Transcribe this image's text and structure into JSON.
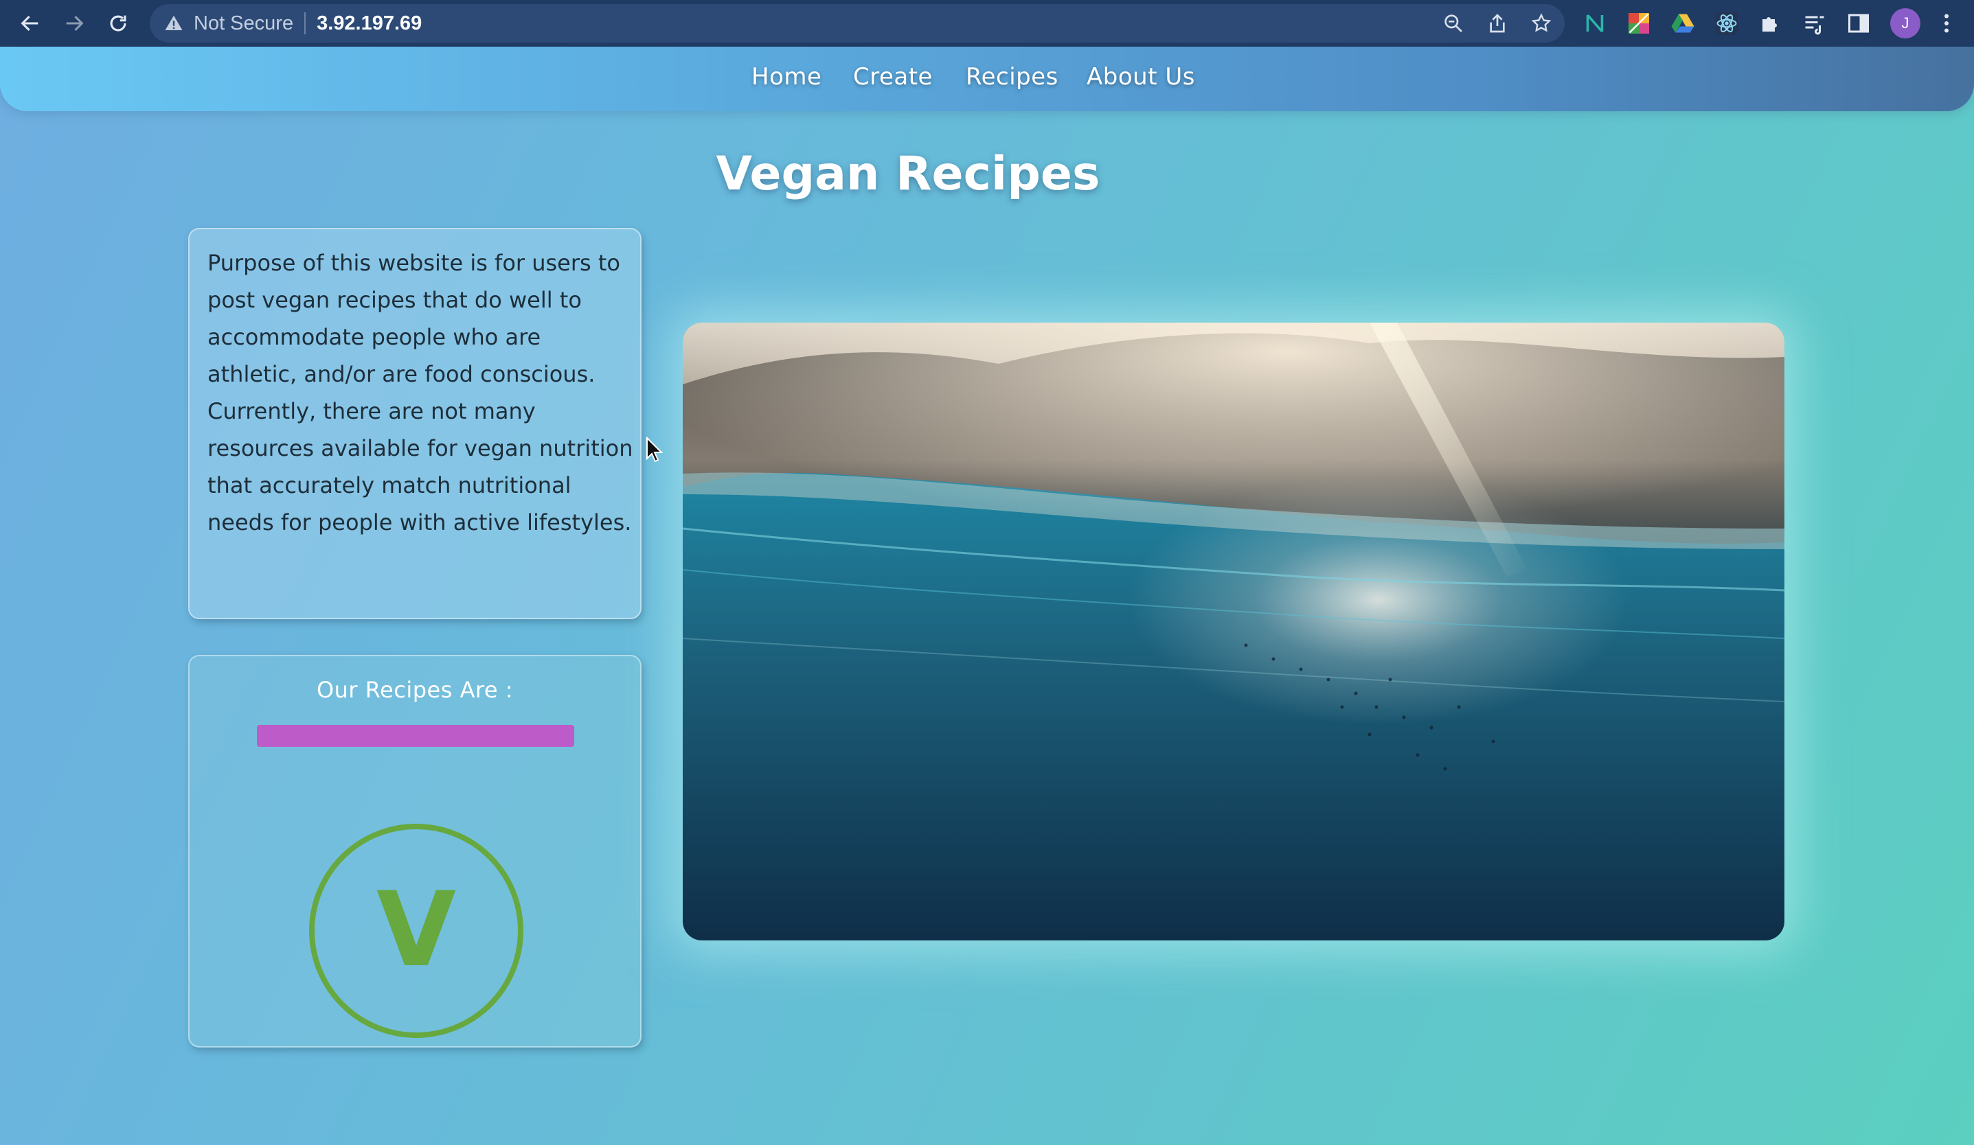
{
  "browser": {
    "security_label": "Not Secure",
    "url": "3.92.197.69",
    "nav_icons": [
      "back-arrow-icon",
      "forward-arrow-icon",
      "reload-icon"
    ],
    "omnibox_icons": [
      "zoom-icon",
      "share-icon",
      "bookmark-star-icon"
    ],
    "extension_icons": [
      "notion-extension-icon",
      "colorful-grid-extension-icon",
      "google-drive-extension-icon",
      "react-devtools-extension-icon",
      "puzzle-extensions-icon",
      "reading-list-icon",
      "side-panel-icon"
    ],
    "profile_initial": "J",
    "menu_icon": "kebab-menu-icon"
  },
  "nav": {
    "items": [
      {
        "label": "Home"
      },
      {
        "label": "Create"
      },
      {
        "label": "Recipes"
      },
      {
        "label": "About Us"
      }
    ]
  },
  "page": {
    "title": "Vegan Recipes",
    "purpose_text": "Purpose of this website is for users to post vegan recipes that do well to accommodate people who are athletic, and/or are food conscious. Currently, there are not many resources available for vegan nutrition that accurately match nutritional needs for people with active lifestyles.",
    "recipes_heading": "Our Recipes Are :",
    "badge_letter": "V"
  },
  "hero": {
    "icon": "aerial-ocean-sunrise-image"
  },
  "colors": {
    "chrome_bg": "#1f3a63",
    "omnibox_bg": "#2d4a76",
    "accent_bar": "#bd5cc8",
    "vegan_green": "#67a83f"
  }
}
